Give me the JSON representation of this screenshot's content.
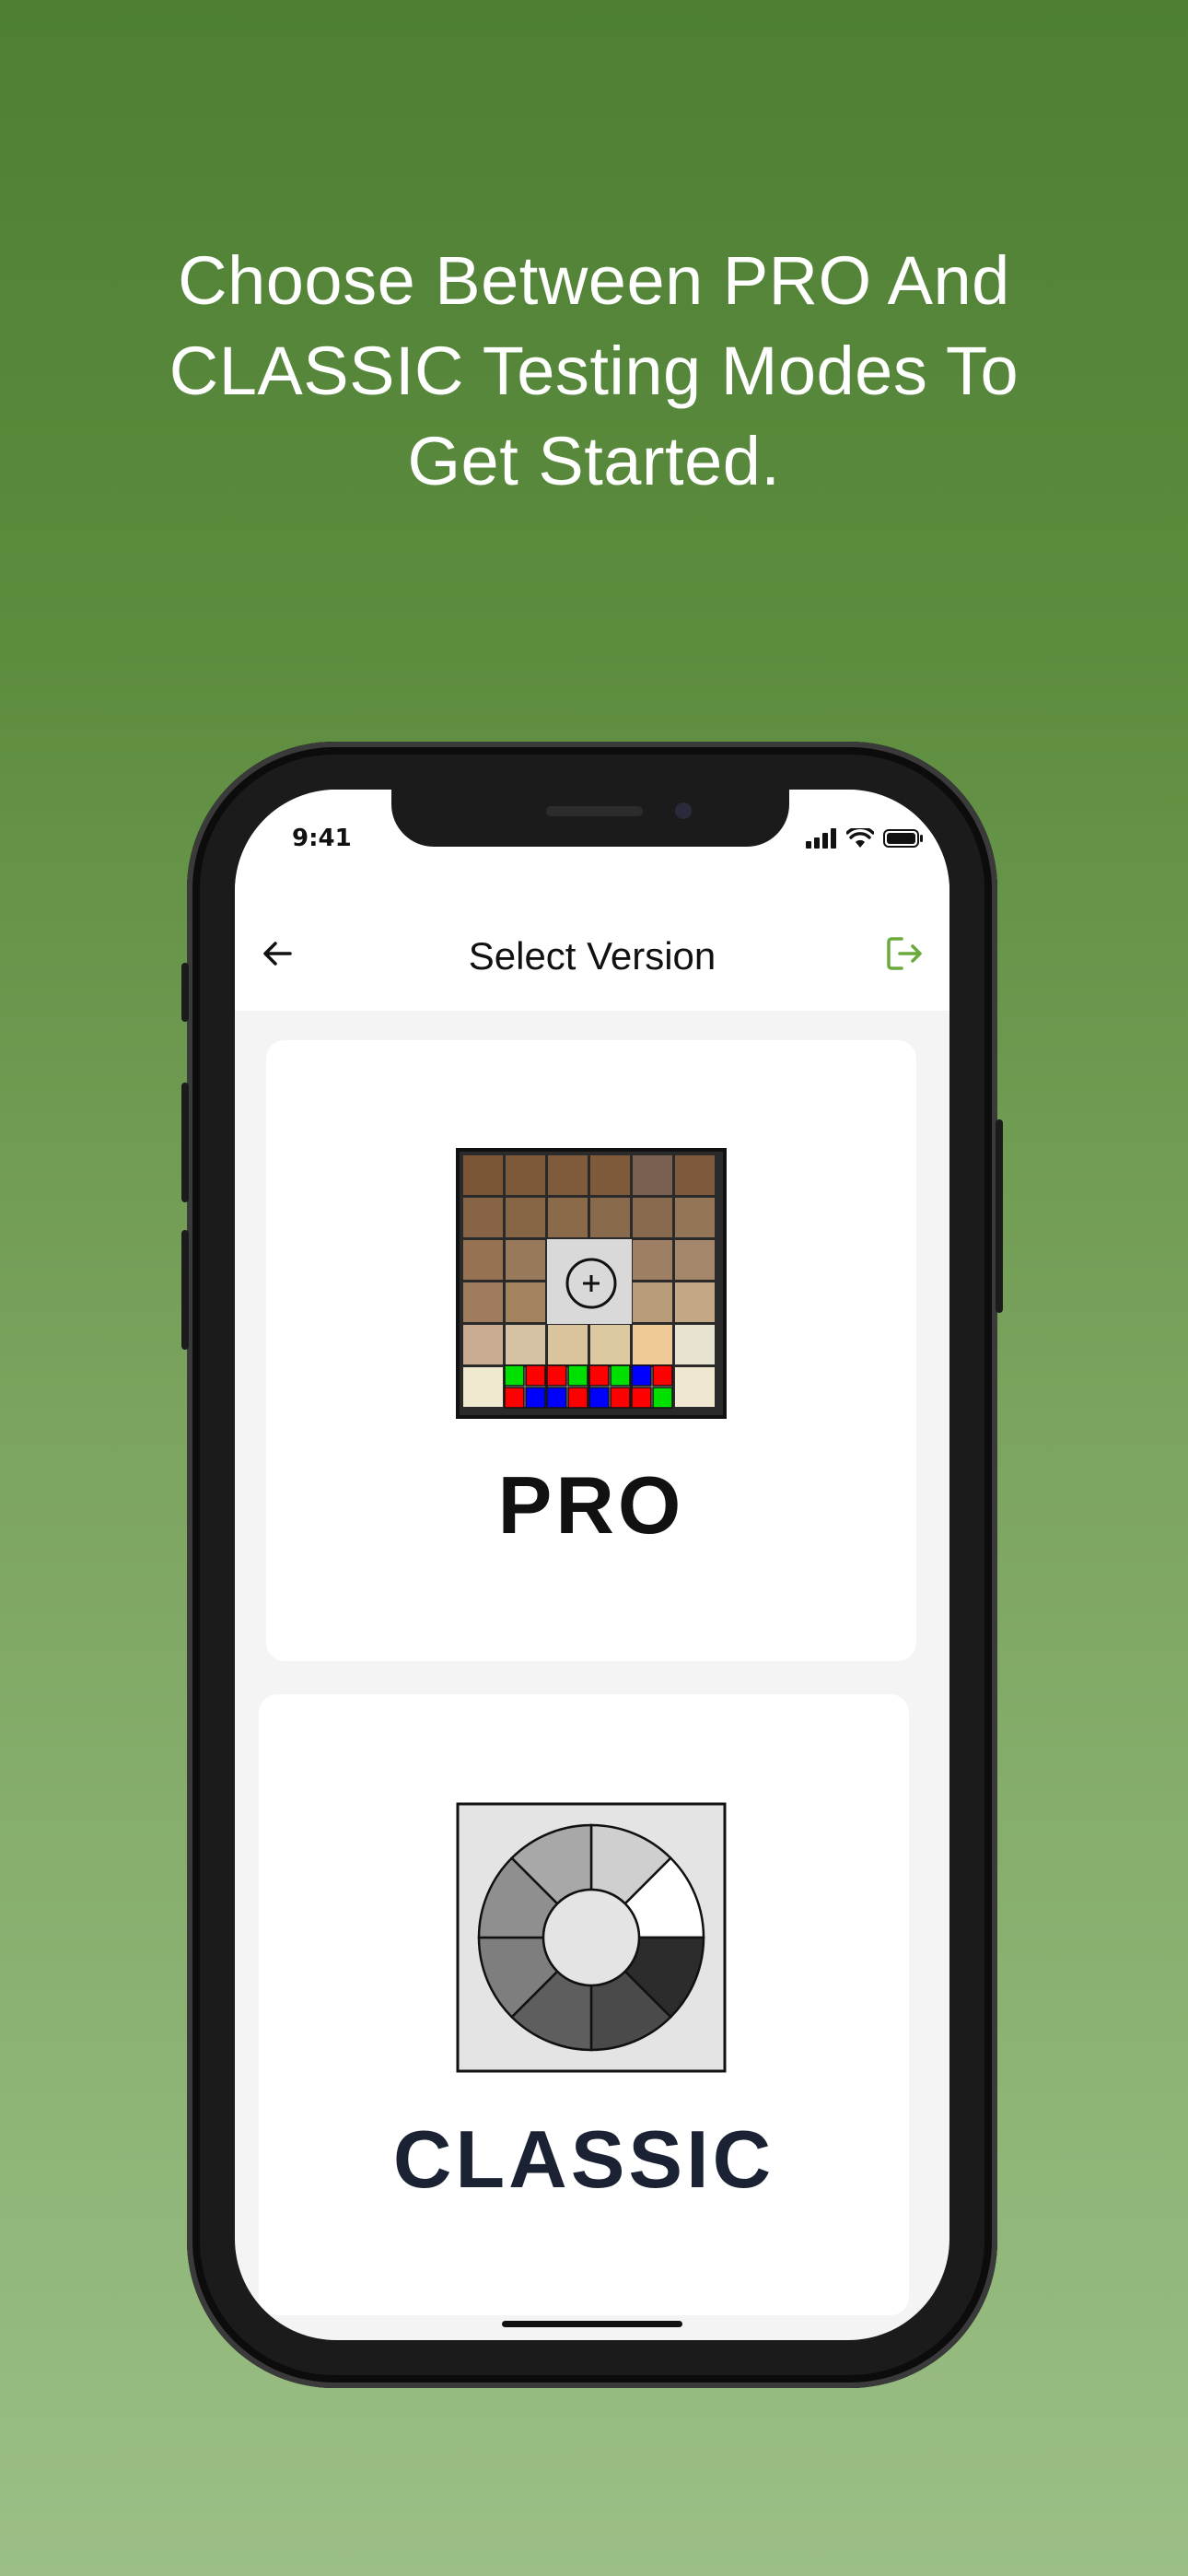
{
  "headline": {
    "line1": "Choose Between PRO And",
    "line2": "CLASSIC Testing Modes To",
    "line3": "Get Started."
  },
  "status_bar": {
    "time": "9:41"
  },
  "header": {
    "title": "Select Version"
  },
  "cards": [
    {
      "label": "PRO",
      "icon": "skin-tone-grid-icon"
    },
    {
      "label": "CLASSIC",
      "icon": "grayscale-wheel-icon"
    }
  ],
  "colors": {
    "background_top": "#4e7f33",
    "background_bottom": "#9bbf86",
    "accent": "#6aaa3a",
    "pro_label": "#111111",
    "classic_label": "#1a2233"
  },
  "pro_icon": {
    "top_rows": [
      [
        "#7a5536",
        "#7e5939",
        "#7f5a3b",
        "#7e5a3b",
        "#7a6050",
        "#7d5a3d"
      ],
      [
        "#876446",
        "#876646",
        "#8b6a4a",
        "#8a6a4c",
        "#8a6a4f",
        "#947558"
      ],
      [
        "#967253",
        "#99795c",
        "#d9d9d9",
        "#d9d9d9",
        "#9e7f63",
        "#a4876a"
      ],
      [
        "#a07c5f",
        "#a4845f",
        "#d9d9d9",
        "#d9d9d9",
        "#b89b78",
        "#c4a886"
      ],
      [
        "#c9ac92",
        "#d6c1a5",
        "#d9c49e",
        "#dcc9a0",
        "#efc998",
        "#e8e3d0"
      ],
      [
        "#efe9cf",
        "#f0f0f0",
        "#f0f0f0",
        "#f0f0f0",
        "#f0f0f0",
        "#f0e7d0"
      ]
    ],
    "test_row_top": [
      "#00e000",
      "#ff0000",
      "#ff0000",
      "#00e000",
      "#ff0000",
      "#00e000",
      "#0000ff",
      "#ff0000"
    ],
    "test_row_bottom": [
      "#ff0000",
      "#0000ff",
      "#0000ff",
      "#ff0000",
      "#0000ff",
      "#ff0000",
      "#ff0000",
      "#00e000"
    ]
  },
  "classic_icon": {
    "segments": [
      "#cfcfcf",
      "#ffffff",
      "#2c2c2c",
      "#4a4a4a",
      "#5e5e5e",
      "#7e7e7e",
      "#8f8f8f",
      "#a8a8a8"
    ]
  }
}
